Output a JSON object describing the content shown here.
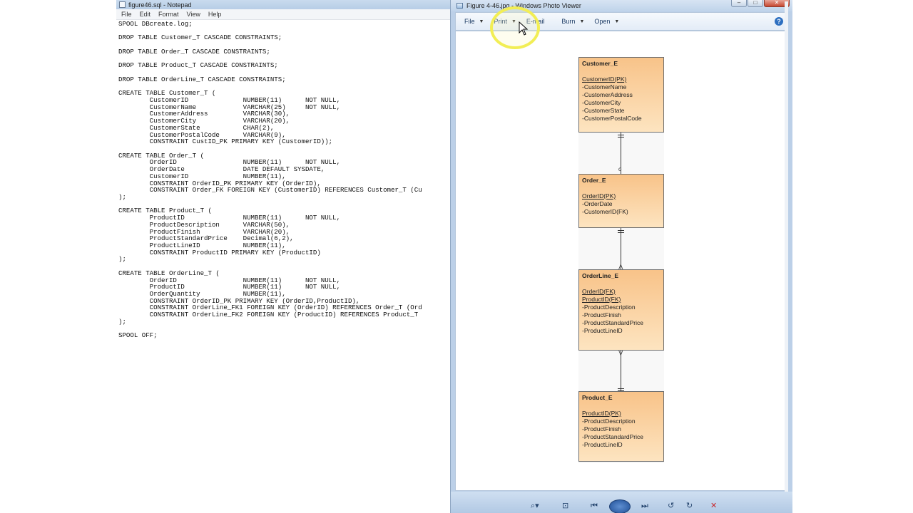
{
  "notepad": {
    "title": "figure46.sql - Notepad",
    "menu": [
      "File",
      "Edit",
      "Format",
      "View",
      "Help"
    ],
    "lines": [
      "SPOOL DBcreate.log;",
      "",
      "DROP TABLE Customer_T CASCADE CONSTRAINTS;",
      "",
      "DROP TABLE Order_T CASCADE CONSTRAINTS;",
      "",
      "DROP TABLE Product_T CASCADE CONSTRAINTS;",
      "",
      "DROP TABLE OrderLine_T CASCADE CONSTRAINTS;",
      "",
      "CREATE TABLE Customer_T (",
      "        CustomerID              NUMBER(11)      NOT NULL,",
      "        CustomerName            VARCHAR(25)     NOT NULL,",
      "        CustomerAddress         VARCHAR(30),",
      "        CustomerCity            VARCHAR(20),",
      "        CustomerState           CHAR(2),",
      "        CustomerPostalCode      VARCHAR(9),",
      "        CONSTRAINT CustID_PK PRIMARY KEY (CustomerID));",
      "",
      "CREATE TABLE Order_T (",
      "        OrderID                 NUMBER(11)      NOT NULL,",
      "        OrderDate               DATE DEFAULT SYSDATE,",
      "        CustomerID              NUMBER(11),",
      "        CONSTRAINT OrderID_PK PRIMARY KEY (OrderID),",
      "        CONSTRAINT Order_FK FOREIGN KEY (CustomerID) REFERENCES Customer_T (Cu",
      ");",
      "",
      "CREATE TABLE Product_T (",
      "        ProductID               NUMBER(11)      NOT NULL,",
      "        ProductDescription      VARCHAR(50),",
      "        ProductFinish           VARCHAR(20),",
      "        ProductStandardPrice    Decimal(6,2),",
      "        ProductLineID           NUMBER(11),",
      "        CONSTRAINT ProductID PRIMARY KEY (ProductID)",
      ");",
      "",
      "CREATE TABLE OrderLine_T (",
      "        OrderID                 NUMBER(11)      NOT NULL,",
      "        ProductID               NUMBER(11)      NOT NULL,",
      "        OrderQuantity           NUMBER(11),",
      "        CONSTRAINT OrderID_PK PRIMARY KEY (OrderID,ProductID),",
      "        CONSTRAINT OrderLine_FK1 FOREIGN KEY (OrderID) REFERENCES Order_T (Ord",
      "        CONSTRAINT OrderLine_FK2 FOREIGN KEY (ProductID) REFERENCES Product_T",
      ");",
      "",
      "SPOOL OFF;"
    ]
  },
  "viewer": {
    "title": "Figure 4-46.jpg - Windows Photo Viewer",
    "window_buttons": {
      "minimize": "–",
      "maximize": "□",
      "close": "✕"
    },
    "toolbar": [
      {
        "label": "File",
        "dropdown": true
      },
      {
        "label": "Print",
        "dropdown": true
      },
      {
        "label": "E-mail",
        "dropdown": false
      },
      {
        "label": "Burn",
        "dropdown": true
      },
      {
        "label": "Open",
        "dropdown": true
      }
    ],
    "help_label": "?",
    "entities": [
      {
        "title": "Customer_E",
        "pk": "CustomerID(PK)",
        "fk": [],
        "attrs": [
          "-CustomerName",
          "-CustomerAddress",
          "-CustomerCity",
          "-CustomerState",
          "-CustomerPostalCode"
        ]
      },
      {
        "title": "Order_E",
        "pk": "OrderID(PK)",
        "fk": [],
        "attrs": [
          "-OrderDate",
          "-CustomerID(FK)"
        ]
      },
      {
        "title": "OrderLine_E",
        "pk": "OrderID(FK)",
        "fk": [
          "ProductID(FK)"
        ],
        "attrs": [
          "-ProductDescription",
          "-ProductFinish",
          "-ProductStandardPrice",
          "-ProductLineID"
        ]
      },
      {
        "title": "Product_E",
        "pk": "ProductID(PK)",
        "fk": [],
        "attrs": [
          "-ProductDescription",
          "-ProductFinish",
          "-ProductStandardPrice",
          "-ProductLineID"
        ]
      }
    ],
    "bottom_icons": [
      "zoom-icon",
      "fit-icon",
      "previous-icon",
      "slideshow-icon",
      "next-icon",
      "rotate-ccw-icon",
      "rotate-cw-icon",
      "delete-icon"
    ]
  },
  "colors": {
    "entity_top": "#f8c389",
    "entity_bottom": "#fde4c0",
    "highlight": "#f2ee55",
    "delete": "#c8282c"
  }
}
